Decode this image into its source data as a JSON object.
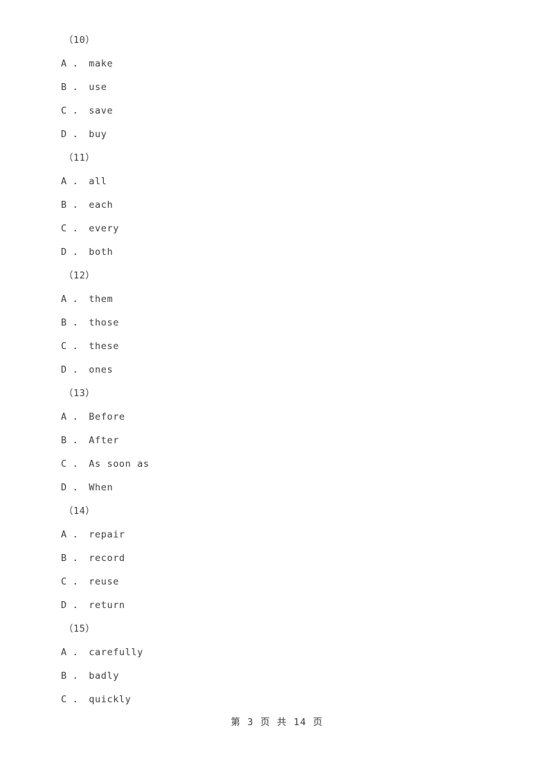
{
  "document": {
    "page_footer": "第 3 页 共 14 页",
    "text_color": "#3f3f3f",
    "background_color": "#ffffff"
  },
  "questions": [
    {
      "number": "（10）",
      "options": [
        "A ． make",
        "B ． use",
        "C ． save",
        "D ． buy"
      ]
    },
    {
      "number": "（11）",
      "options": [
        "A ． all",
        "B ． each",
        "C ． every",
        "D ． both"
      ]
    },
    {
      "number": "（12）",
      "options": [
        "A ． them",
        "B ． those",
        "C ． these",
        "D ． ones"
      ]
    },
    {
      "number": "（13）",
      "options": [
        "A ． Before",
        "B ． After",
        "C ． As soon as",
        "D ． When"
      ]
    },
    {
      "number": "（14）",
      "options": [
        "A ． repair",
        "B ． record",
        "C ． reuse",
        "D ． return"
      ]
    },
    {
      "number": "（15）",
      "options": [
        "A ． carefully",
        "B ． badly",
        "C ． quickly"
      ]
    }
  ]
}
